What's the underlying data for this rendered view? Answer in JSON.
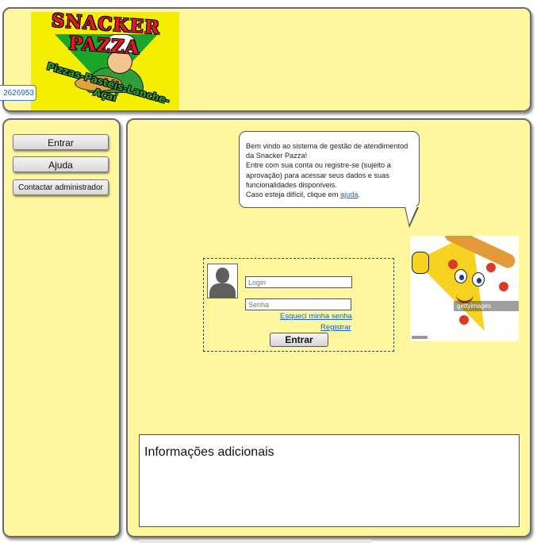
{
  "header": {
    "logo_title": "SNACKER PAZZA",
    "logo_subtitle": "Pizzas-Pastéis-Lanche-Açaí",
    "left_tag": "2626953"
  },
  "sidebar": {
    "buttons": [
      {
        "label": "Entrar"
      },
      {
        "label": "Ajuda"
      },
      {
        "label": "Contactar administrador"
      }
    ]
  },
  "main": {
    "bubble": {
      "line1": "Bem vindo ao sistema de gestão de atendimentod da Snacker Pazza!",
      "line2": "Entre com sua conta ou registre-se (sujeito a aprovação) para acessar seus dados e suas funcionalidades disponíveis.",
      "line3_prefix": "Caso esteja difícil, clique em ",
      "help_link": "ajuda",
      "line3_suffix": "."
    },
    "mascot": {
      "watermark": "gettyimages"
    },
    "login": {
      "login_placeholder": "Login",
      "login_value": "",
      "password_placeholder": "Senha",
      "password_value": "",
      "forgot_link": "Esqueci minha senha",
      "register_link": "Registrar",
      "submit_label": "Entrar"
    },
    "info": {
      "title": "Informações adicionais"
    }
  },
  "colors": {
    "panel_bg": "#fff79e",
    "panel_border": "#6a6a6a",
    "link": "#1a5fbf"
  }
}
